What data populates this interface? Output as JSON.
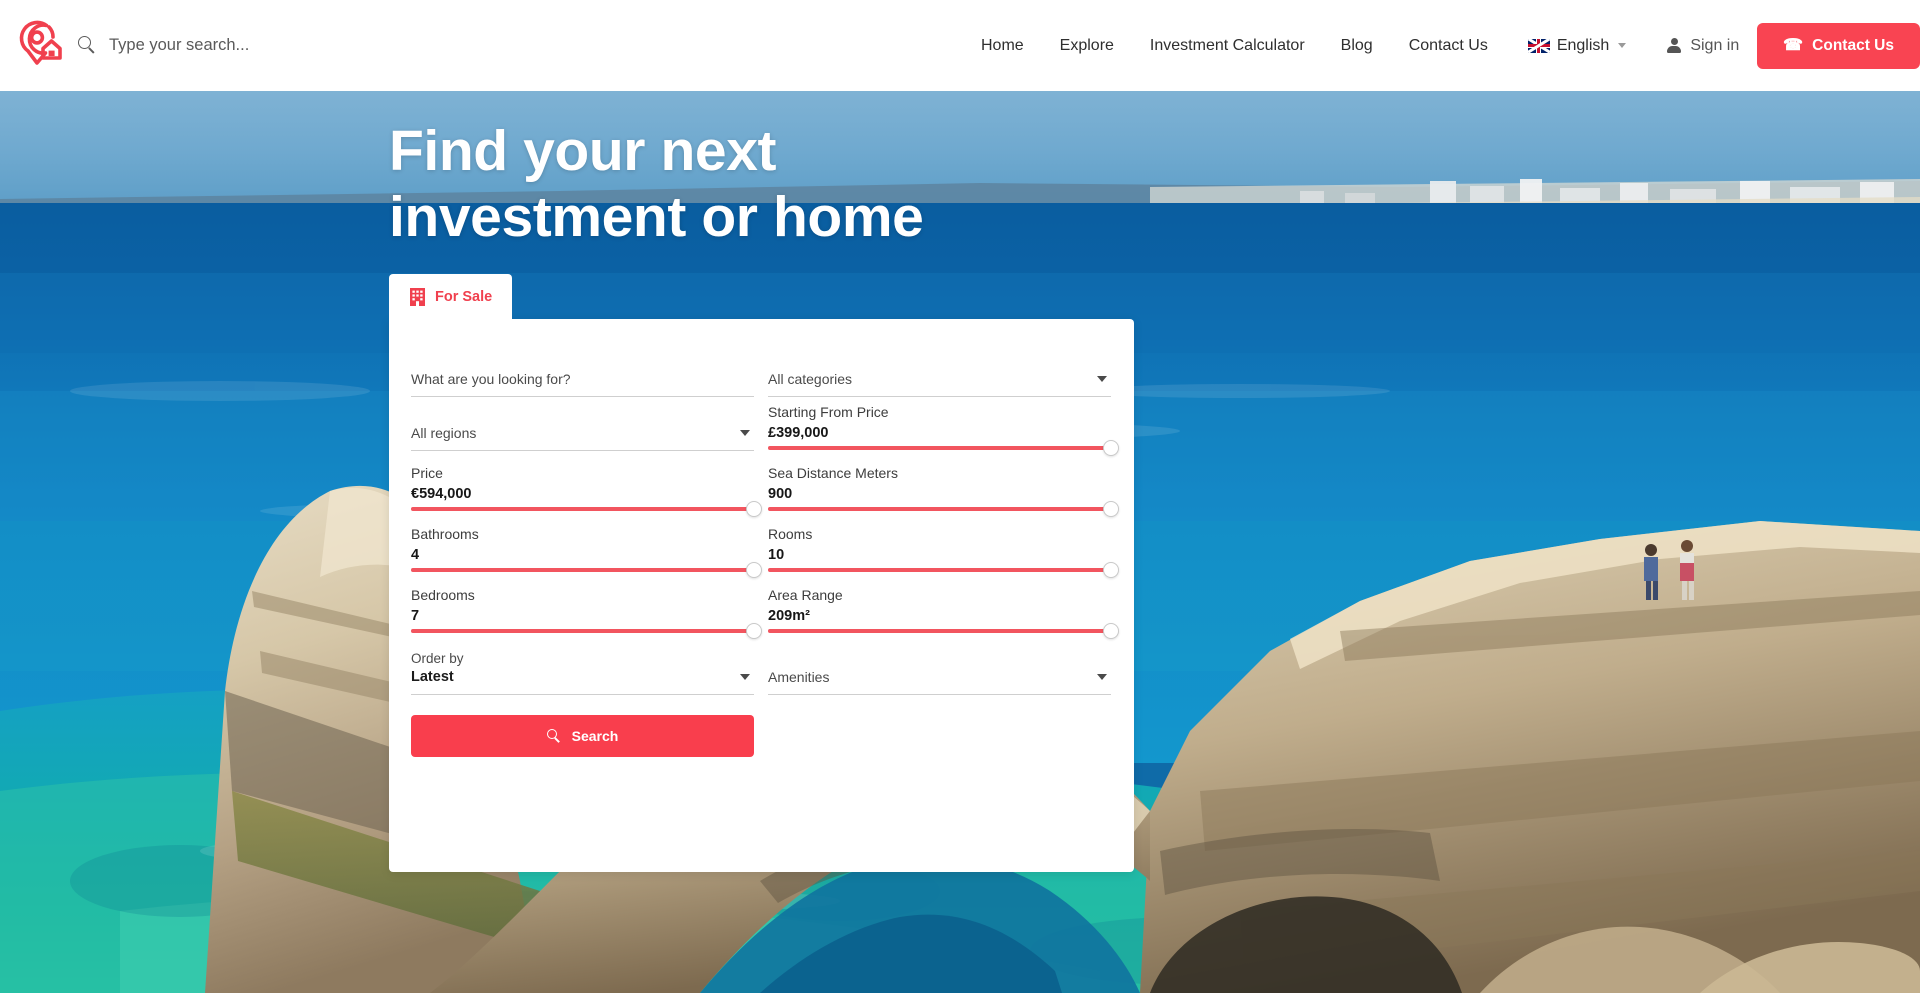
{
  "header": {
    "logo_alt": "map-pin-house-logo",
    "search": {
      "placeholder": "Type your search...",
      "value": ""
    },
    "nav": [
      {
        "label": "Home"
      },
      {
        "label": "Explore"
      },
      {
        "label": "Investment Calculator"
      },
      {
        "label": "Blog"
      },
      {
        "label": "Contact Us"
      }
    ],
    "language": {
      "label": "English",
      "flag": "uk-flag-icon"
    },
    "sign_in": "Sign in",
    "contact_button": "Contact Us",
    "accent_color": "#F94452"
  },
  "hero": {
    "title": "Find your next\ninvestment or home"
  },
  "search_panel": {
    "tab": {
      "label": "For Sale",
      "icon": "building-icon"
    },
    "keyword": {
      "label": "What are you looking for?",
      "placeholder": "",
      "value": ""
    },
    "categories": {
      "label": "All categories",
      "value": ""
    },
    "regions": {
      "label": "All regions",
      "value": ""
    },
    "sliders": [
      {
        "name": "starting_from_price",
        "label": "Starting From Price",
        "value": "£399,000",
        "percent": 100
      },
      {
        "name": "price",
        "label": "Price",
        "value": "€594,000",
        "percent": 100
      },
      {
        "name": "sea_distance_meters",
        "label": "Sea Distance Meters",
        "value": "900",
        "percent": 100
      },
      {
        "name": "bathrooms",
        "label": "Bathrooms",
        "value": "4",
        "percent": 100
      },
      {
        "name": "rooms",
        "label": "Rooms",
        "value": "10",
        "percent": 100
      },
      {
        "name": "bedrooms",
        "label": "Bedrooms",
        "value": "7",
        "percent": 100
      },
      {
        "name": "area_range",
        "label": "Area Range",
        "value": "209m²",
        "percent": 100
      }
    ],
    "order_by": {
      "label": "Order by",
      "value": "Latest"
    },
    "amenities": {
      "label": "Amenities",
      "value": ""
    },
    "search_button": "Search"
  }
}
